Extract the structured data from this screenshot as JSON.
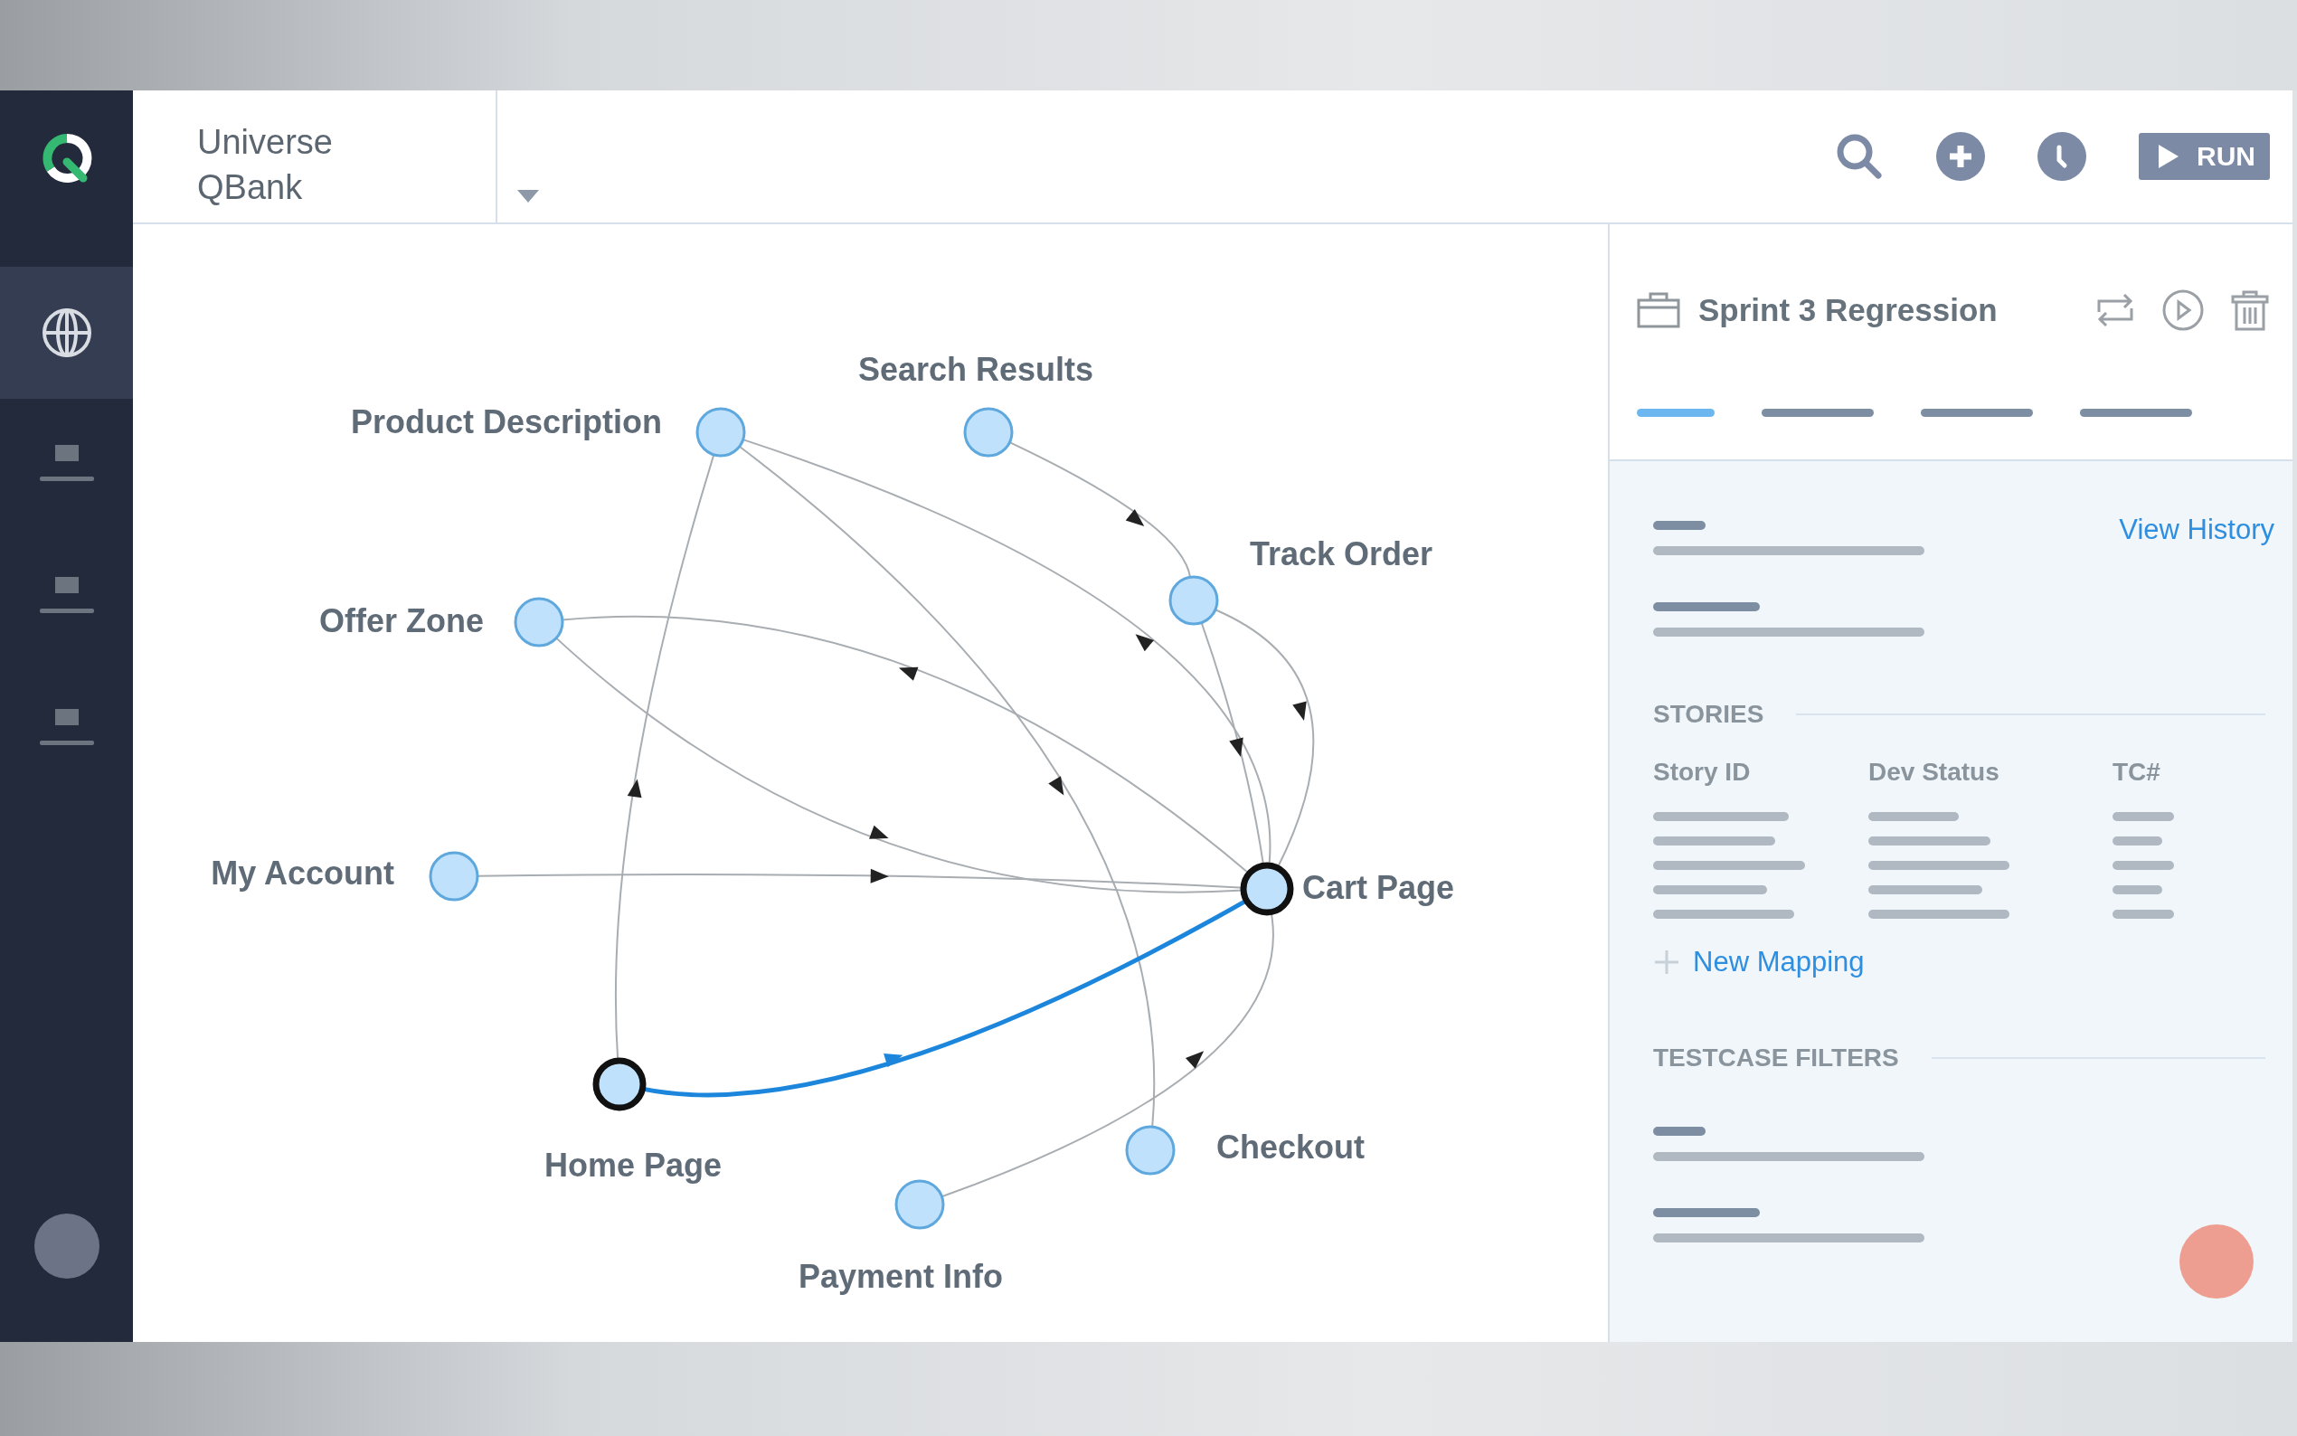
{
  "sidebar": {
    "items": [
      {
        "kind": "globe",
        "selected": true
      },
      {
        "kind": "monitor",
        "selected": false
      },
      {
        "kind": "monitor",
        "selected": false
      },
      {
        "kind": "monitor",
        "selected": false
      }
    ]
  },
  "project": {
    "name": "Universe QBank"
  },
  "toolbar": {
    "run_label": "RUN"
  },
  "graph": {
    "nodes": [
      {
        "label": "Product Description",
        "selected": false
      },
      {
        "label": "Search Results",
        "selected": false
      },
      {
        "label": "Track Order",
        "selected": false
      },
      {
        "label": "Offer Zone",
        "selected": false
      },
      {
        "label": "My Account",
        "selected": false
      },
      {
        "label": "Cart Page",
        "selected": true
      },
      {
        "label": "Home Page",
        "selected": true
      },
      {
        "label": "Checkout",
        "selected": false
      },
      {
        "label": "Payment Info",
        "selected": false
      }
    ],
    "edges": [
      {
        "highlighted": false
      },
      {
        "highlighted": false
      },
      {
        "highlighted": false
      },
      {
        "highlighted": false
      },
      {
        "highlighted": false
      },
      {
        "highlighted": false
      },
      {
        "highlighted": false
      },
      {
        "highlighted": false
      },
      {
        "highlighted": false
      },
      {
        "highlighted": true
      },
      {
        "highlighted": false
      }
    ]
  },
  "panel": {
    "title": "Sprint 3 Regression",
    "tabs": [
      {
        "selected": true
      },
      {
        "selected": false
      },
      {
        "selected": false
      },
      {
        "selected": false
      }
    ],
    "view_history": "View History",
    "stories": {
      "heading": "STORIES",
      "columns": [
        "Story ID",
        "Dev Status",
        "TC#"
      ]
    },
    "new_mapping": "New Mapping",
    "filters": {
      "heading": "TESTCASE FILTERS"
    }
  }
}
